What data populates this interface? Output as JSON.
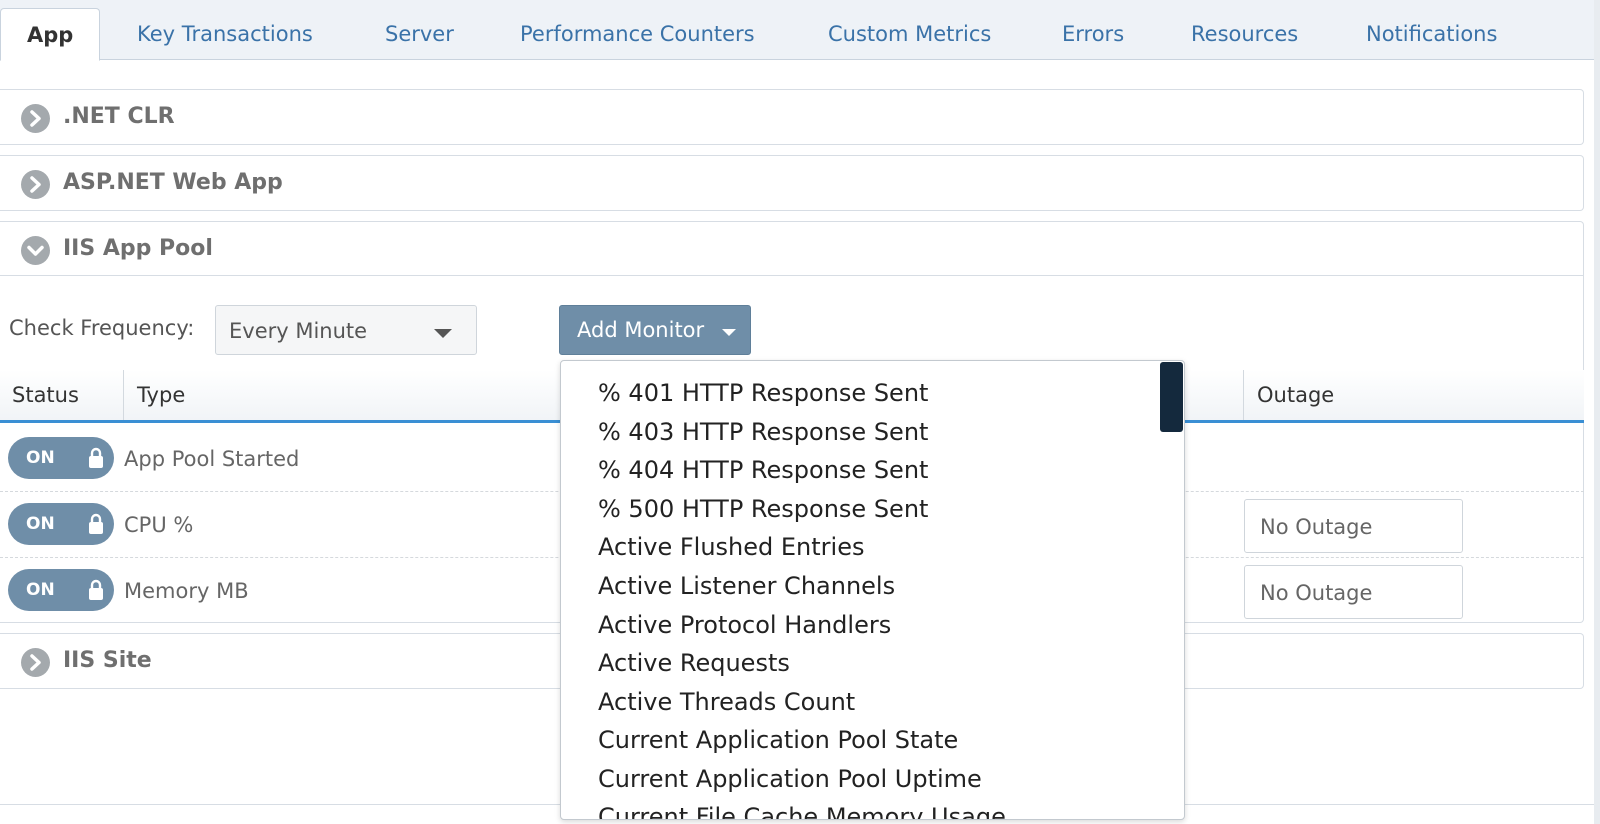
{
  "tabs": [
    {
      "label": "App"
    },
    {
      "label": "Key Transactions"
    },
    {
      "label": "Server"
    },
    {
      "label": "Performance Counters"
    },
    {
      "label": "Custom Metrics"
    },
    {
      "label": "Errors"
    },
    {
      "label": "Resources"
    },
    {
      "label": "Notifications"
    }
  ],
  "panels": {
    "net_clr": {
      "title": ".NET CLR",
      "expanded": false
    },
    "aspnet": {
      "title": "ASP.NET Web App",
      "expanded": false
    },
    "iis_pool": {
      "title": "IIS App Pool",
      "expanded": true
    },
    "iis_site": {
      "title": "IIS Site",
      "expanded": false
    }
  },
  "controls": {
    "check_frequency_label": "Check Frequency:",
    "check_frequency_value": "Every Minute",
    "add_monitor_label": "Add Monitor"
  },
  "table": {
    "headers": {
      "status": "Status",
      "type": "Type",
      "outage": "Outage"
    },
    "rows": [
      {
        "status": "ON",
        "type": "App Pool Started",
        "outage": ""
      },
      {
        "status": "ON",
        "type": "CPU %",
        "outage": "No Outage"
      },
      {
        "status": "ON",
        "type": "Memory MB",
        "outage": "No Outage"
      }
    ]
  },
  "dropdown": {
    "items": [
      "% 401 HTTP Response Sent",
      "% 403 HTTP Response Sent",
      "% 404 HTTP Response Sent",
      "% 500 HTTP Response Sent",
      "Active Flushed Entries",
      "Active Listener Channels",
      "Active Protocol Handlers",
      "Active Requests",
      "Active Threads Count",
      "Current Application Pool State",
      "Current Application Pool Uptime",
      "Current File Cache Memory Usage"
    ]
  },
  "colors": {
    "link": "#3a72a8",
    "toggle_bg": "#6f8ea8",
    "table_header_rule": "#3a8fd4",
    "scroll_thumb": "#14293d"
  }
}
